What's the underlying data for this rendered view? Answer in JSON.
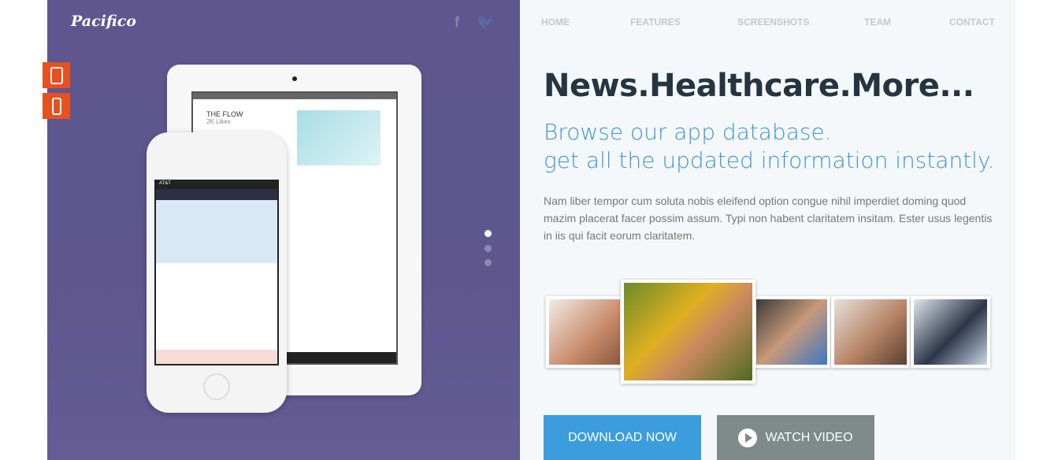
{
  "logo": "Pacifico",
  "social": [
    "facebook-icon",
    "twitter-icon"
  ],
  "nav": [
    "HOME",
    "FEATURES",
    "SCREENSHOTS",
    "TEAM",
    "CONTACT"
  ],
  "hero": {
    "title": "News.Healthcare.More...",
    "subtitle_line1": "Browse our app database.",
    "subtitle_line2": "get all the updated information instantly.",
    "body": "Nam liber tempor cum soluta nobis eleifend option congue nihil imperdiet doming quod mazim placerat facer possim assum. Typi non habent claritatem insitam. Ester usus legentis in iis qui facit eorum claritatem."
  },
  "ipad_screen": {
    "title": "THE FLOW",
    "likes": "2K Likes"
  },
  "iphone_screen": {
    "carrier": "AT&T"
  },
  "slider": {
    "active": 1,
    "count": 3
  },
  "buttons": {
    "download": "DOWNLOAD NOW",
    "watch": "WATCH VIDEO"
  },
  "colors": {
    "accent": "#3f95d1",
    "orange": "#e8501e",
    "purple": "#5f5690",
    "download": "#3b9ddd",
    "watch": "#7f8a8a"
  }
}
